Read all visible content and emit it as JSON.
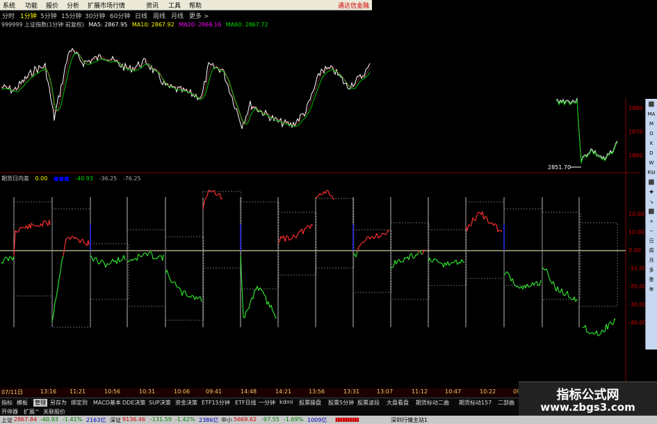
{
  "menu": {
    "items": [
      "系统",
      "功能",
      "报价",
      "分析",
      "扩展市场行情",
      "资讯",
      "工具",
      "帮助"
    ],
    "brand": "通达信金融"
  },
  "period": {
    "items": [
      "分时",
      "1分钟",
      "5分钟",
      "15分钟",
      "30分钟",
      "60分钟",
      "日线",
      "周线",
      "月线",
      "更多 >"
    ],
    "active_index": 1
  },
  "index_line": {
    "title": "999999 上证指数(1分钟 前复权)",
    "ma5": "MA5: 2867.95",
    "ma10": "MA10: 2867.92",
    "ma20": "MA20: 2869.16",
    "ma60": "MA60: 2867.72"
  },
  "sub_line": {
    "title": "期货日内差",
    "v1": "0.00",
    "v2": "-40.93",
    "v3": "-36.25",
    "v4": "-76.25"
  },
  "price_axis": [
    "2880",
    "2870",
    "2860"
  ],
  "sub_axis": [
    "20.00",
    "10.00",
    "0.00",
    "-10.00",
    "-20.00",
    "-30.00",
    "-40.00"
  ],
  "price_annotation": "2851.70",
  "time_axis": [
    "07/11日",
    "13:16",
    "11:21",
    "10:56",
    "10:31",
    "10:06",
    "09:41",
    "14:48",
    "14:21",
    "13:56",
    "13:31",
    "13:07",
    "11:12",
    "10:47",
    "10:22",
    "09:"
  ],
  "tabs": [
    "指标",
    "模板",
    "管理",
    "另存为",
    "绑定到",
    "MACD基本",
    "DDE决策",
    "SUP决策",
    "资金决策",
    "ETF15分钟",
    "ETF日线",
    "一分钟",
    "kdmi",
    "股票操盘",
    "股票5分钟",
    "股票波段",
    "大盘看盘",
    "期货标动二曲",
    "期货标动157",
    "二部曲"
  ],
  "tabs_active_index": 2,
  "tabs2": [
    "开停器",
    "扩展^",
    "关联报价"
  ],
  "status": {
    "sh": "上证",
    "sh_val": "2867.84",
    "sh_chg": "-40.93",
    "sh_pct": "-1.41%",
    "sh_amt": "2163亿",
    "sz": "深证",
    "sz_val": "9136.46",
    "sz_chg": "-131.59",
    "sz_pct": "-1.42%",
    "sz_amt": "2386亿",
    "zx": "中小",
    "zx_val": "5669.62",
    "zx_chg": "-97.55",
    "zx_pct": "-1.69%",
    "zx_amt": "1009亿",
    "server": "深圳行情主站1"
  },
  "right_panel": [
    "⬛",
    "MA",
    "M",
    "O",
    "K",
    "D",
    "W",
    "RSI",
    "⬛",
    "✚",
    "↘",
    "⬛",
    "+",
    "−",
    "日",
    "周",
    "月",
    "多",
    "季",
    "年"
  ],
  "watermark": {
    "line1": "指标公式网",
    "line2": "www.zbgs3.com"
  }
}
